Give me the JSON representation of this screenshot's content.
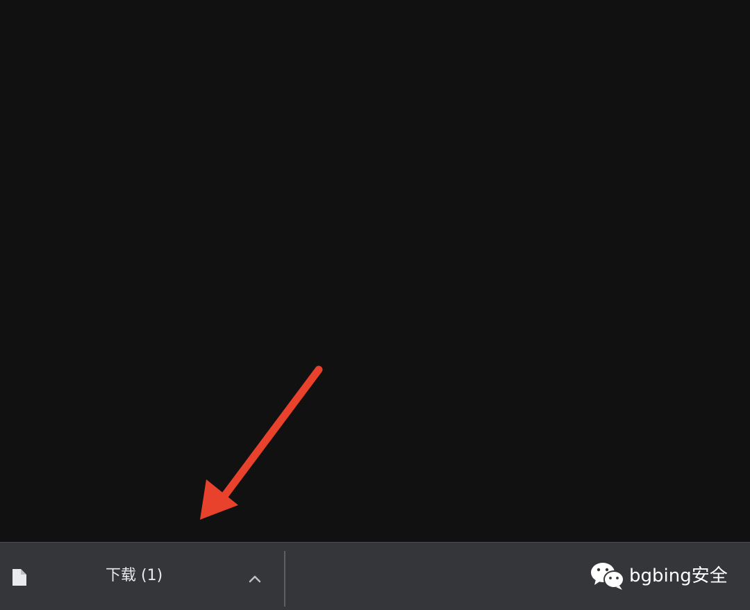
{
  "download_shelf": {
    "item_label": "下载 (1)",
    "file_icon": "file-icon",
    "expand_icon": "chevron-up-icon"
  },
  "annotation": {
    "arrow_icon": "red-arrow-annotation",
    "arrow_color": "#e8412c"
  },
  "watermark": {
    "icon": "wechat-icon",
    "text": "bgbing安全"
  },
  "colors": {
    "page_background": "#111112",
    "shelf_background": "#35363a",
    "text": "#e8eaed"
  }
}
